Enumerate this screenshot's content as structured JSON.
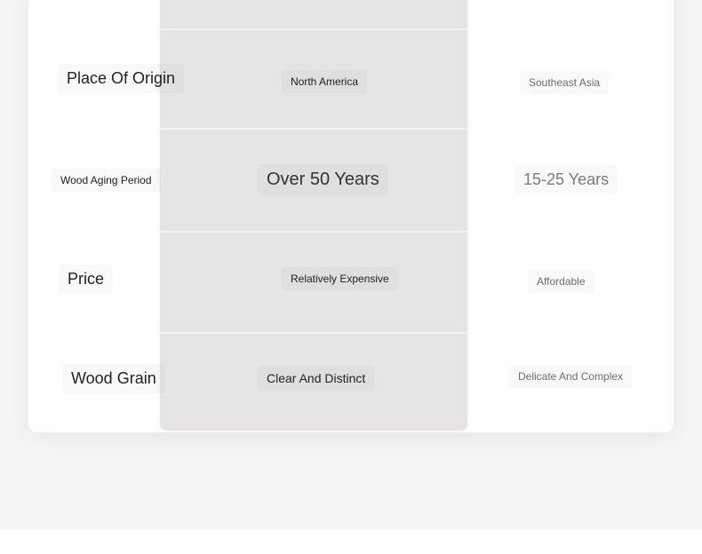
{
  "comparison": {
    "rows": [
      {
        "attribute": "Place Of Origin",
        "option_a": "North America",
        "option_b": "Southeast Asia"
      },
      {
        "attribute": "Wood Aging Period",
        "option_a": "Over 50 Years",
        "option_b": "15-25 Years"
      },
      {
        "attribute": "Price",
        "option_a": "Relatively Expensive",
        "option_b": "Affordable"
      },
      {
        "attribute": "Wood Grain",
        "option_a": "Clear And Distinct",
        "option_b": "Delicate And Complex"
      }
    ]
  },
  "colors": {
    "page_background": "#f5f5f5",
    "card_background": "#ffffff",
    "highlight_column": "#e6e4e4",
    "label_text": "#222222",
    "muted_text": "#6e6e6e"
  }
}
